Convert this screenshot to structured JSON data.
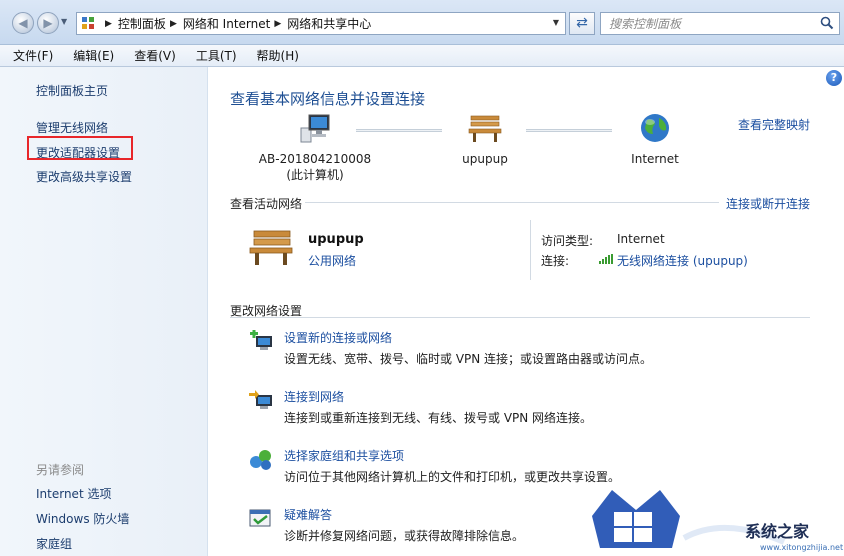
{
  "addressbar": {
    "breadcrumbs": [
      "控制面板",
      "网络和 Internet",
      "网络和共享中心"
    ],
    "search_placeholder": "搜索控制面板"
  },
  "menu": [
    "文件(F)",
    "编辑(E)",
    "查看(V)",
    "工具(T)",
    "帮助(H)"
  ],
  "sidebar": {
    "home": "控制面板主页",
    "items": [
      "管理无线网络",
      "更改适配器设置",
      "更改高级共享设置"
    ],
    "see_also_title": "另请参阅",
    "see_also": [
      "Internet 选项",
      "Windows 防火墙",
      "家庭组"
    ]
  },
  "main": {
    "title": "查看基本网络信息并设置连接",
    "view_full_map": "查看完整映射",
    "map": {
      "computer_name": "AB-201804210008",
      "computer_sub": "(此计算机)",
      "network_name": "upupup",
      "internet": "Internet"
    },
    "active_section": "查看活动网络",
    "connect_disconnect": "连接或断开连接",
    "active": {
      "name": "upupup",
      "type": "公用网络",
      "access_label": "访问类型:",
      "access_value": "Internet",
      "conn_label": "连接:",
      "conn_value": "无线网络连接 (upupup)"
    },
    "change_section": "更改网络设置",
    "tasks": [
      {
        "title": "设置新的连接或网络",
        "desc": "设置无线、宽带、拨号、临时或 VPN 连接；或设置路由器或访问点。"
      },
      {
        "title": "连接到网络",
        "desc": "连接到或重新连接到无线、有线、拨号或 VPN 网络连接。"
      },
      {
        "title": "选择家庭组和共享选项",
        "desc": "访问位于其他网络计算机上的文件和打印机，或更改共享设置。"
      },
      {
        "title": "疑难解答",
        "desc": "诊断并修复网络问题，或获得故障排除信息。"
      }
    ]
  },
  "watermark": {
    "text": "系统之家",
    "url": "www.xitongzhijia.net"
  },
  "colors": {
    "link": "#1c4fa0",
    "title": "#1e4f93",
    "highlight": "#e8262a"
  }
}
